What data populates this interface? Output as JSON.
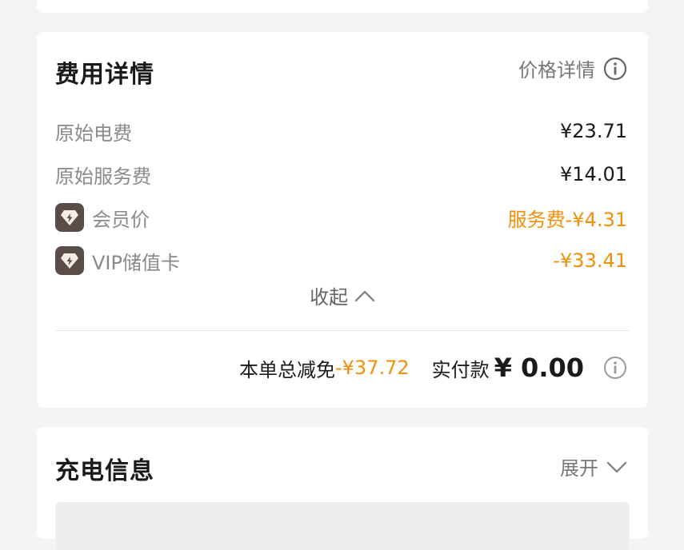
{
  "fee_details": {
    "title": "费用详情",
    "price_details_link": "价格详情",
    "rows": [
      {
        "label": "原始电费",
        "value": "¥23.71"
      },
      {
        "label": "原始服务费",
        "value": "¥14.01"
      },
      {
        "label": "会员价",
        "value": "服务费-¥4.31"
      },
      {
        "label": "VIP储值卡",
        "value": "-¥33.41"
      }
    ],
    "collapse_label": "收起",
    "total_discount_label": "本单总减免",
    "total_discount_value": "-¥37.72",
    "actual_paid_label": "实付款",
    "actual_paid_value": "¥ 0.00"
  },
  "charge_info": {
    "title": "充电信息",
    "expand_label": "展开"
  },
  "colors": {
    "accent_orange": "#f0900a",
    "badge_bg": "#5a4d49",
    "page_bg": "#f4f4f5"
  }
}
